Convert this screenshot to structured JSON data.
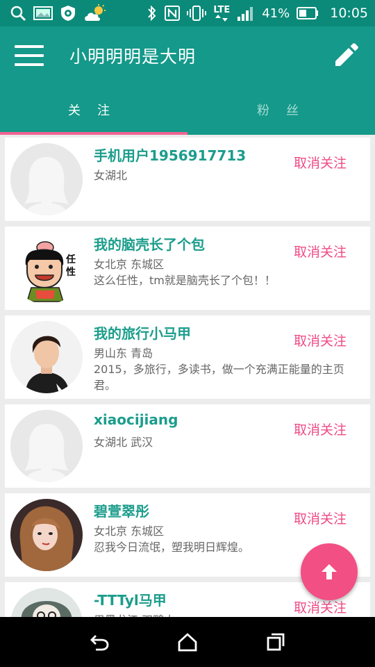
{
  "status_bar": {
    "battery": "41%",
    "network": "LTE",
    "time": "10:05",
    "icons": [
      "search-icon",
      "photo-icon",
      "shield-icon",
      "weather-icon",
      "bluetooth-icon",
      "nfc-icon",
      "vibrate-icon",
      "signal-icon",
      "battery-icon"
    ]
  },
  "app_bar": {
    "title": "小明明明是大明",
    "menu_icon": "hamburger-menu-icon",
    "edit_icon": "pencil-icon"
  },
  "tabs": [
    {
      "label": "关注",
      "active": true
    },
    {
      "label": "粉丝",
      "active": false
    }
  ],
  "users": [
    {
      "name": "手机用户1956917713",
      "location": "女湖北",
      "bio": "",
      "action": "取消关注",
      "avatar": "default-avatar"
    },
    {
      "name": "我的脑壳长了个包",
      "location": "女北京 东城区",
      "bio": "这么任性，tm就是脑壳长了个包！！",
      "action": "取消关注",
      "avatar": "cartoon-avatar"
    },
    {
      "name": "我的旅行小马甲",
      "location": "男山东 青岛",
      "bio": "2015，多旅行，多读书，做一个充满正能量的主页君。",
      "action": "取消关注",
      "avatar": "photo-avatar"
    },
    {
      "name": "xiaocijiang",
      "location": "女湖北 武汉",
      "bio": "",
      "action": "取消关注",
      "avatar": "default-avatar"
    },
    {
      "name": "碧萱翠彤",
      "location": "女北京 东城区",
      "bio": "忍我今日流氓，塑我明日辉煌。",
      "action": "取消关注",
      "avatar": "photo-avatar"
    },
    {
      "name": "-TTTyl马甲",
      "location": "男黑龙江 双鸭山",
      "bio": "",
      "action": "取消关注",
      "avatar": "illustration-avatar"
    }
  ],
  "fab": {
    "icon": "arrow-up-icon"
  },
  "nav_bar": {
    "icons": [
      "back-icon",
      "home-icon",
      "recents-icon"
    ]
  },
  "colors": {
    "status_bar": "#0b8a79",
    "primary": "#14998a",
    "accent": "#ee4b85",
    "name_text": "#1c9d8c"
  }
}
